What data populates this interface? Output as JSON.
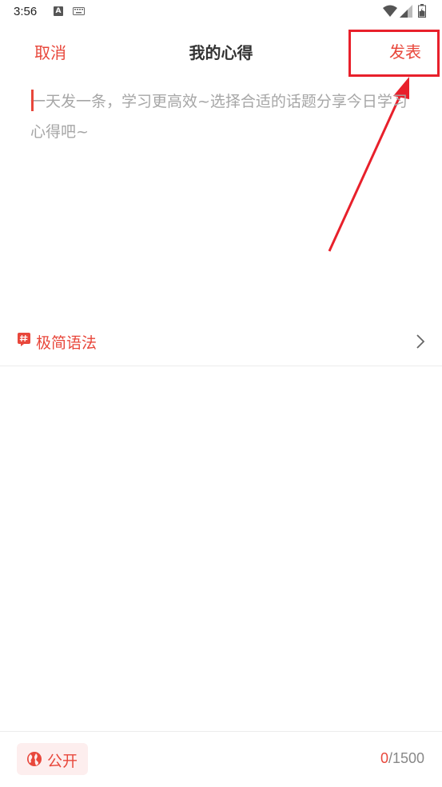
{
  "status_bar": {
    "time": "3:56",
    "a_badge": "A"
  },
  "nav": {
    "cancel_label": "取消",
    "title": "我的心得",
    "publish_label": "发表"
  },
  "editor": {
    "placeholder": "一天发一条，学习更高效~选择合适的话题分享今日学习心得吧~"
  },
  "topic": {
    "label": "极简语法"
  },
  "bottom": {
    "visibility_label": "公开",
    "count_current": "0",
    "count_max": "/1500"
  },
  "colors": {
    "accent": "#e8473b",
    "annotation": "#e8202b"
  },
  "icons": [
    "keyboard-icon",
    "wifi-icon",
    "signal-icon",
    "battery-icon",
    "hashtag-icon",
    "chevron-right-icon",
    "globe-icon"
  ]
}
